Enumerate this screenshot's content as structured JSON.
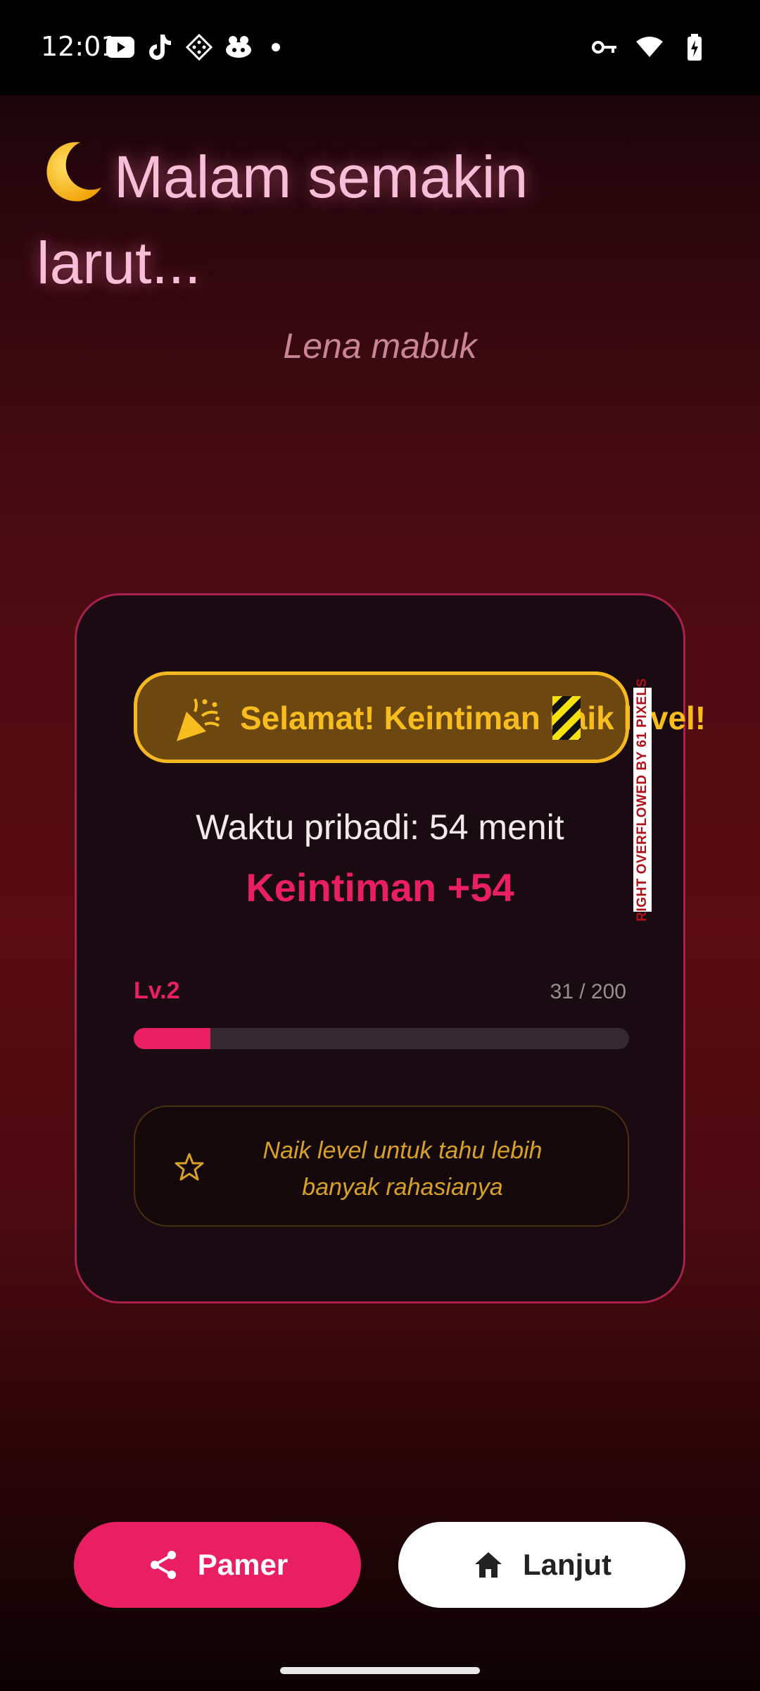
{
  "status_bar": {
    "time": "12:01",
    "left_icons": [
      "youtube-icon",
      "tiktok-icon",
      "pattern-app-icon",
      "game-app-icon",
      "notification-dot-icon"
    ],
    "right_icons": [
      "vpn-key-icon",
      "wifi-icon",
      "battery-charging-icon"
    ]
  },
  "header": {
    "emoji": "moon-icon",
    "title": "Malam semakin larut...",
    "subtitle": "Lena mabuk"
  },
  "card": {
    "banner_icon": "party-popper-icon",
    "banner_text": "Selamat! Keintiman naik level!",
    "overflow_warning": "RIGHT OVERFLOWED BY 61 PIXELS",
    "time_text": "Waktu pribadi: 54 menit",
    "points_text": "Keintiman +54",
    "level": {
      "label": "Lv.2",
      "current": 31,
      "max": 200,
      "count_text": "31 / 200",
      "progress_fraction": 0.155
    },
    "hint": {
      "icon": "star-outline-icon",
      "text": "Naik level untuk tahu lebih banyak rahasianya"
    }
  },
  "actions": {
    "share_label": "Pamer",
    "share_icon": "share-icon",
    "next_label": "Lanjut",
    "next_icon": "home-icon"
  },
  "colors": {
    "accent": "#e91e63",
    "gold": "#f5b820",
    "title": "#f8bed7"
  }
}
